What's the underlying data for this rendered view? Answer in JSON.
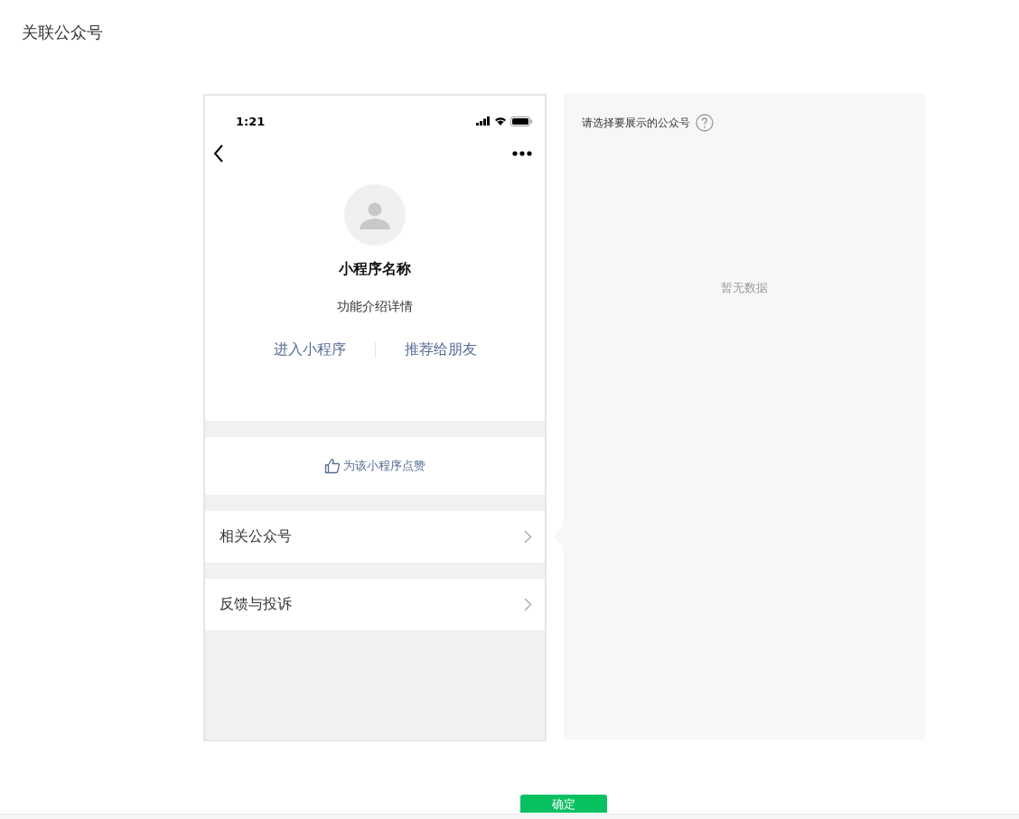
{
  "page_title": "关联公众号",
  "phone": {
    "status_time": "1:21",
    "app_name": "小程序名称",
    "description": "功能介绍详情",
    "actions": [
      "进入小程序",
      "推荐给朋友"
    ],
    "like_label": "为该小程序点赞",
    "menu_items": [
      {
        "label": "相关公众号"
      },
      {
        "label": "反馈与投诉"
      }
    ]
  },
  "panel": {
    "prompt": "请选择要展示的公众号",
    "empty_text": "暂无数据"
  },
  "confirm_button": "确定"
}
